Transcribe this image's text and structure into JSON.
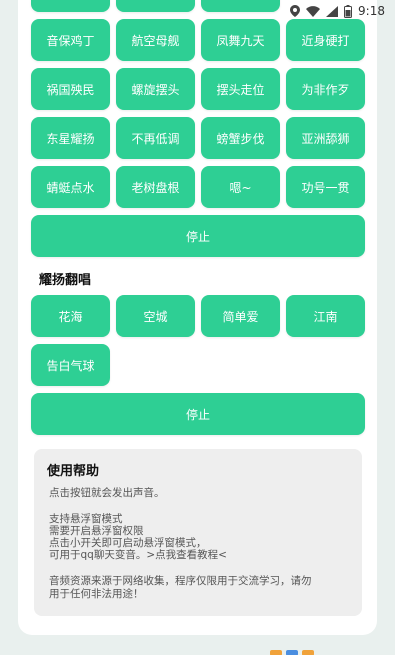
{
  "status": {
    "time": "9:18"
  },
  "rows": [
    [
      "",
      "",
      "",
      ""
    ],
    [
      "音保鸡丁",
      "航空母舰",
      "凤舞九天",
      "近身硬打"
    ],
    [
      "祸国殃民",
      "螺旋摆头",
      "摆头走位",
      "为非作歹"
    ],
    [
      "东星耀扬",
      "不再低调",
      "螃蟹步伐",
      "亚洲舔狮"
    ],
    [
      "蜻蜓点水",
      "老树盘根",
      "嗯~",
      "功号一贯"
    ]
  ],
  "stop_button_1": "停止",
  "section2": {
    "title": "耀扬翻唱",
    "songs": [
      "花海",
      "空城",
      "简单爱",
      "江南",
      "告白气球"
    ]
  },
  "stop_button_2": "停止",
  "help": {
    "title": "使用帮助",
    "line1": "点击按钮就会发出声音。",
    "line2": "支持悬浮窗模式",
    "line3": "需要开启悬浮窗权限",
    "line4": "点击小开关即可启动悬浮窗模式，",
    "line5": "可用于qq聊天变音。>点我查看教程<",
    "line6": "音频资源来源于网络收集，程序仅限用于交流学习，请勿",
    "line7": "用于任何非法用途！"
  },
  "colors": {
    "accent": "#2ecf94",
    "background": "#e9f0ee"
  }
}
